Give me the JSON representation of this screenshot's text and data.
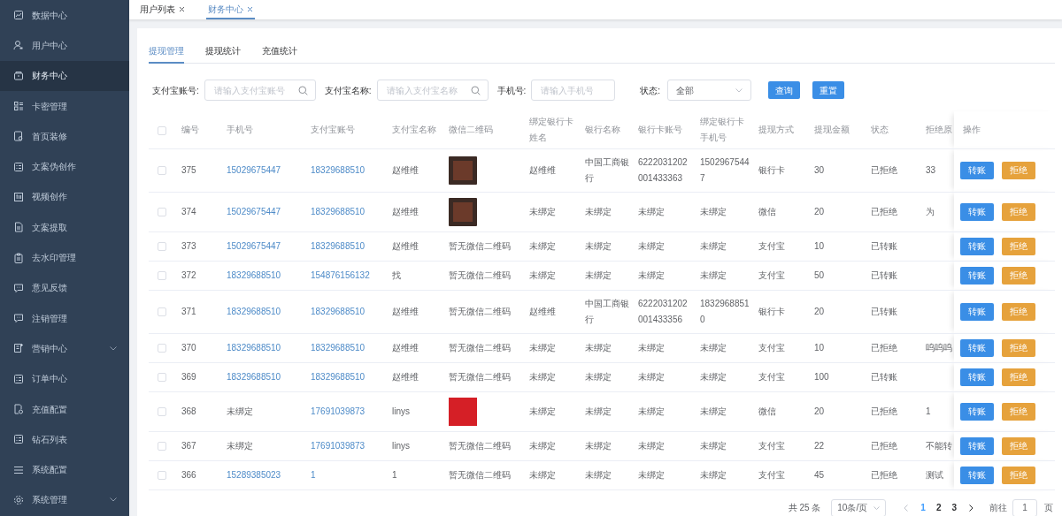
{
  "sidebar": {
    "items": [
      {
        "label": "数据中心",
        "selected": false,
        "has_submenu": false
      },
      {
        "label": "用户中心",
        "selected": false,
        "has_submenu": false
      },
      {
        "label": "财务中心",
        "selected": true,
        "has_submenu": false
      },
      {
        "label": "卡密管理",
        "selected": false,
        "has_submenu": false
      },
      {
        "label": "首页装修",
        "selected": false,
        "has_submenu": false
      },
      {
        "label": "文案伪创作",
        "selected": false,
        "has_submenu": false
      },
      {
        "label": "视频创作",
        "selected": false,
        "has_submenu": false
      },
      {
        "label": "文案提取",
        "selected": false,
        "has_submenu": false
      },
      {
        "label": "去水印管理",
        "selected": false,
        "has_submenu": false
      },
      {
        "label": "意见反馈",
        "selected": false,
        "has_submenu": false
      },
      {
        "label": "注销管理",
        "selected": false,
        "has_submenu": false
      },
      {
        "label": "营销中心",
        "selected": false,
        "has_submenu": true
      },
      {
        "label": "订单中心",
        "selected": false,
        "has_submenu": false
      },
      {
        "label": "充值配置",
        "selected": false,
        "has_submenu": false
      },
      {
        "label": "钻石列表",
        "selected": false,
        "has_submenu": false
      },
      {
        "label": "系统配置",
        "selected": false,
        "has_submenu": false
      },
      {
        "label": "系统管理",
        "selected": false,
        "has_submenu": true
      }
    ]
  },
  "page_tabs": [
    {
      "label": "用户列表",
      "selected": false
    },
    {
      "label": "财务中心",
      "selected": true
    }
  ],
  "sub_tabs": [
    {
      "label": "提现管理",
      "selected": true
    },
    {
      "label": "提现统计",
      "selected": false
    },
    {
      "label": "充值统计",
      "selected": false
    }
  ],
  "filters": [
    {
      "kind": "search",
      "label": "支付宝账号:",
      "placeholder": "请输入支付宝账号"
    },
    {
      "kind": "search",
      "label": "支付宝名称:",
      "placeholder": "请输入支付宝名称"
    },
    {
      "kind": "text",
      "label": "手机号:",
      "placeholder": "请输入手机号"
    },
    {
      "kind": "select",
      "label": "状态:",
      "value": "全部"
    }
  ],
  "filter_buttons": [
    "查询",
    "重置"
  ],
  "table": {
    "all_checked": false,
    "columns": [
      "编号",
      "手机号",
      "支付宝账号",
      "支付宝名称",
      "微信二维码",
      "绑定银行卡姓名",
      "银行名称",
      "银行卡账号",
      "绑定银行卡手机号",
      "提现方式",
      "提现金额",
      "状态",
      "拒绝原",
      "操作"
    ],
    "rows": [
      {
        "checked": false,
        "id": "375",
        "phone": {
          "text": "15029675447",
          "link": true
        },
        "alipay_account": {
          "text": "18329688510",
          "link": true
        },
        "alipay_name": "赵维维",
        "wechat_qr": {
          "kind": "photo"
        },
        "card_holder": "赵维维",
        "bank_name": "中国工商银行",
        "card_number": "6222031202001433363",
        "card_phone": "15029675447",
        "method": "银行卡",
        "amount": "30",
        "status": "已拒绝",
        "reason": "33",
        "actions": [
          {
            "kind": "primary",
            "label": "转账"
          },
          {
            "kind": "warning",
            "label": "拒绝"
          }
        ]
      },
      {
        "checked": false,
        "id": "374",
        "phone": {
          "text": "15029675447",
          "link": true
        },
        "alipay_account": {
          "text": "18329688510",
          "link": true
        },
        "alipay_name": "赵维维",
        "wechat_qr": {
          "kind": "photo"
        },
        "card_holder": "未绑定",
        "bank_name": "未绑定",
        "card_number": "未绑定",
        "card_phone": "未绑定",
        "method": "微信",
        "amount": "20",
        "status": "已拒绝",
        "reason": "为",
        "actions": [
          {
            "kind": "primary",
            "label": "转账"
          },
          {
            "kind": "warning",
            "label": "拒绝"
          }
        ]
      },
      {
        "checked": false,
        "id": "373",
        "phone": {
          "text": "15029675447",
          "link": true
        },
        "alipay_account": {
          "text": "18329688510",
          "link": true
        },
        "alipay_name": "赵维维",
        "wechat_qr": {
          "kind": "text",
          "text": "暂无微信二维码"
        },
        "card_holder": "未绑定",
        "bank_name": "未绑定",
        "card_number": "未绑定",
        "card_phone": "未绑定",
        "method": "支付宝",
        "amount": "10",
        "status": "已转账",
        "actions": [
          {
            "kind": "primary",
            "label": "转账"
          },
          {
            "kind": "warning",
            "label": "拒绝"
          }
        ]
      },
      {
        "checked": false,
        "id": "372",
        "phone": {
          "text": "18329688510",
          "link": true
        },
        "alipay_account": {
          "text": "154876156132",
          "link": true
        },
        "alipay_name": "找",
        "wechat_qr": {
          "kind": "text",
          "text": "暂无微信二维码"
        },
        "card_holder": "未绑定",
        "bank_name": "未绑定",
        "card_number": "未绑定",
        "card_phone": "未绑定",
        "method": "支付宝",
        "amount": "50",
        "status": "已转账",
        "actions": [
          {
            "kind": "primary",
            "label": "转账"
          },
          {
            "kind": "warning",
            "label": "拒绝"
          }
        ]
      },
      {
        "checked": false,
        "id": "371",
        "phone": {
          "text": "18329688510",
          "link": true
        },
        "alipay_account": {
          "text": "18329688510",
          "link": true
        },
        "alipay_name": "赵维维",
        "wechat_qr": {
          "kind": "text",
          "text": "暂无微信二维码"
        },
        "card_holder": "赵维维",
        "bank_name": "中国工商银行",
        "card_number": "6222031202001433356",
        "card_phone": "18329688510",
        "method": "银行卡",
        "amount": "20",
        "status": "已转账",
        "actions": [
          {
            "kind": "primary",
            "label": "转账"
          },
          {
            "kind": "warning",
            "label": "拒绝"
          }
        ]
      },
      {
        "checked": false,
        "id": "370",
        "phone": {
          "text": "18329688510",
          "link": true
        },
        "alipay_account": {
          "text": "18329688510",
          "link": true
        },
        "alipay_name": "赵维维",
        "wechat_qr": {
          "kind": "text",
          "text": "暂无微信二维码"
        },
        "card_holder": "未绑定",
        "bank_name": "未绑定",
        "card_number": "未绑定",
        "card_phone": "未绑定",
        "method": "支付宝",
        "amount": "10",
        "status": "已拒绝",
        "reason": "呜呜呜",
        "actions": [
          {
            "kind": "primary",
            "label": "转账"
          },
          {
            "kind": "warning",
            "label": "拒绝"
          }
        ]
      },
      {
        "checked": false,
        "id": "369",
        "phone": {
          "text": "18329688510",
          "link": true
        },
        "alipay_account": {
          "text": "18329688510",
          "link": true
        },
        "alipay_name": "赵维维",
        "wechat_qr": {
          "kind": "text",
          "text": "暂无微信二维码"
        },
        "card_holder": "未绑定",
        "bank_name": "未绑定",
        "card_number": "未绑定",
        "card_phone": "未绑定",
        "method": "支付宝",
        "amount": "100",
        "status": "已转账",
        "actions": [
          {
            "kind": "primary",
            "label": "转账"
          },
          {
            "kind": "warning",
            "label": "拒绝"
          }
        ]
      },
      {
        "checked": false,
        "id": "368",
        "phone": {
          "text": "未绑定",
          "link": false
        },
        "alipay_account": {
          "text": "17691039873",
          "link": true
        },
        "alipay_name": "linys",
        "wechat_qr": {
          "kind": "logo"
        },
        "card_holder": "未绑定",
        "bank_name": "未绑定",
        "card_number": "未绑定",
        "card_phone": "未绑定",
        "method": "微信",
        "amount": "20",
        "status": "已拒绝",
        "reason": "1",
        "actions": [
          {
            "kind": "primary",
            "label": "转账"
          },
          {
            "kind": "warning",
            "label": "拒绝"
          }
        ]
      },
      {
        "checked": false,
        "id": "367",
        "phone": {
          "text": "未绑定",
          "link": false
        },
        "alipay_account": {
          "text": "17691039873",
          "link": true
        },
        "alipay_name": "linys",
        "wechat_qr": {
          "kind": "text",
          "text": "暂无微信二维码"
        },
        "card_holder": "未绑定",
        "bank_name": "未绑定",
        "card_number": "未绑定",
        "card_phone": "未绑定",
        "method": "支付宝",
        "amount": "22",
        "status": "已拒绝",
        "reason": "不能转",
        "actions": [
          {
            "kind": "primary",
            "label": "转账"
          },
          {
            "kind": "warning",
            "label": "拒绝"
          }
        ]
      },
      {
        "checked": false,
        "id": "366",
        "phone": {
          "text": "15289385023",
          "link": true
        },
        "alipay_account": {
          "text": "1",
          "link": true
        },
        "alipay_name": "1",
        "wechat_qr": {
          "kind": "text",
          "text": "暂无微信二维码"
        },
        "card_holder": "未绑定",
        "bank_name": "未绑定",
        "card_number": "未绑定",
        "card_phone": "未绑定",
        "method": "支付宝",
        "amount": "45",
        "status": "已拒绝",
        "reason": "测试",
        "actions": [
          {
            "kind": "primary",
            "label": "转账"
          },
          {
            "kind": "warning",
            "label": "拒绝"
          }
        ]
      }
    ]
  },
  "pagination": {
    "total": "共 25 条",
    "page_size": "10条/页",
    "pages": [
      {
        "label": "1",
        "selected": true
      },
      {
        "label": "2",
        "selected": false
      },
      {
        "label": "3",
        "selected": false
      }
    ],
    "goto_label": "前往",
    "goto_value": "1",
    "suffix": "页"
  }
}
